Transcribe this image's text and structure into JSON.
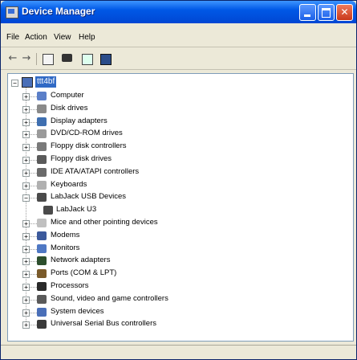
{
  "window": {
    "title": "Device Manager"
  },
  "menu": {
    "file": "File",
    "action": "Action",
    "view": "View",
    "help": "Help"
  },
  "tree": {
    "root": "ttt4bf",
    "nodes": [
      {
        "label": "Computer",
        "icon": "computer-icon",
        "color": "#5b7fc8",
        "expander": "+"
      },
      {
        "label": "Disk drives",
        "icon": "disk-drive-icon",
        "color": "#8a8a8a",
        "expander": "+"
      },
      {
        "label": "Display adapters",
        "icon": "display-adapter-icon",
        "color": "#3f6fb0",
        "expander": "+"
      },
      {
        "label": "DVD/CD-ROM drives",
        "icon": "dvd-icon",
        "color": "#9a9a9a",
        "expander": "+"
      },
      {
        "label": "Floppy disk controllers",
        "icon": "floppy-controller-icon",
        "color": "#7a7a7a",
        "expander": "+"
      },
      {
        "label": "Floppy disk drives",
        "icon": "floppy-drive-icon",
        "color": "#5a5a5a",
        "expander": "+"
      },
      {
        "label": "IDE ATA/ATAPI controllers",
        "icon": "ide-controller-icon",
        "color": "#6a6a6a",
        "expander": "+"
      },
      {
        "label": "Keyboards",
        "icon": "keyboard-icon",
        "color": "#b0b0b0",
        "expander": "+"
      },
      {
        "label": "LabJack USB Devices",
        "icon": "usb-device-icon",
        "color": "#4a4a4a",
        "expander": "−",
        "children": [
          {
            "label": "LabJack U3",
            "icon": "labjack-icon",
            "color": "#4a4a4a"
          }
        ]
      },
      {
        "label": "Mice and other pointing devices",
        "icon": "mouse-icon",
        "color": "#c0c0c0",
        "expander": "+"
      },
      {
        "label": "Modems",
        "icon": "modem-icon",
        "color": "#3c5a9c",
        "expander": "+"
      },
      {
        "label": "Monitors",
        "icon": "monitor-icon",
        "color": "#4f78c4",
        "expander": "+"
      },
      {
        "label": "Network adapters",
        "icon": "network-adapter-icon",
        "color": "#2d4f2d",
        "expander": "+"
      },
      {
        "label": "Ports (COM & LPT)",
        "icon": "port-icon",
        "color": "#7a5a2a",
        "expander": "+"
      },
      {
        "label": "Processors",
        "icon": "processor-icon",
        "color": "#2a2a2a",
        "expander": "+"
      },
      {
        "label": "Sound, video and game controllers",
        "icon": "sound-icon",
        "color": "#5a5a5a",
        "expander": "+"
      },
      {
        "label": "System devices",
        "icon": "system-device-icon",
        "color": "#4a6fb8",
        "expander": "+"
      },
      {
        "label": "Universal Serial Bus controllers",
        "icon": "usb-controller-icon",
        "color": "#3a3a3a",
        "expander": "+"
      }
    ]
  }
}
